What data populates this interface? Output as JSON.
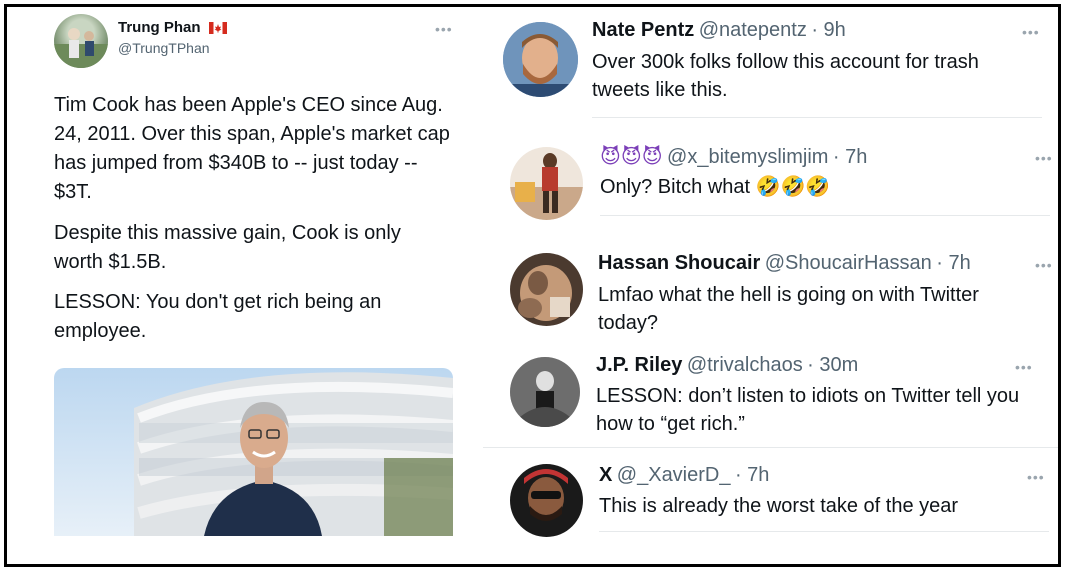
{
  "main_tweet": {
    "name": "Trung Phan",
    "handle": "@TrungTPhan",
    "paragraphs": [
      "Tim Cook has been Apple's CEO since Aug. 24, 2011. Over this span, Apple's market cap has jumped from $340B to -- just today -- $3T.",
      "Despite this massive gain, Cook is only worth $1.5B.",
      "LESSON: You don't get rich being an employee."
    ]
  },
  "replies": [
    {
      "name": "Nate Pentz",
      "handle": "@natepentz",
      "time": "· 9h",
      "text": "Over 300k folks follow this account for trash tweets like this."
    },
    {
      "name": "😈😈😈",
      "handle": "@x_bitemyslimjim",
      "time": "· 7h",
      "text": "Only? Bitch what 🤣🤣🤣"
    },
    {
      "name": "Hassan Shoucair",
      "handle": "@ShoucairHassan",
      "time": "· 7h",
      "text": "Lmfao what the hell is going on with Twitter today?"
    },
    {
      "name": "J.P. Riley",
      "handle": "@trivalchaos",
      "time": "· 30m",
      "text": "LESSON: don’t listen to idiots on Twitter tell you how to “get rich.”"
    },
    {
      "name": "X",
      "handle": "@_XavierD_",
      "time": "· 7h",
      "text": "This is already the worst take of the year"
    }
  ],
  "more_glyph": "•••",
  "colors": {
    "text": "#0f1419",
    "secondary": "#536471",
    "border": "#000000"
  }
}
